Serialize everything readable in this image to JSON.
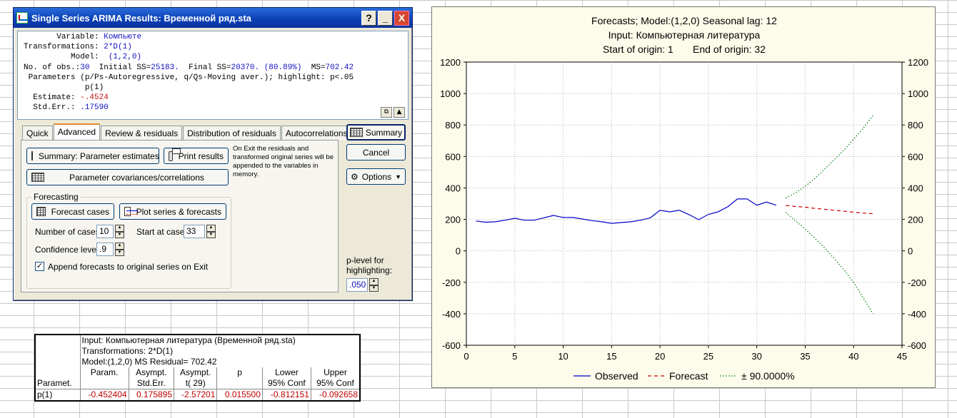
{
  "window": {
    "title": "Single Series ARIMA Results: Временной ряд.sta",
    "help": "?",
    "minimize": "_",
    "close": "X"
  },
  "results": {
    "variable_label": "Variable:",
    "variable": "Компьюте",
    "transformations_label": "Transformations:",
    "transformations": "2*D(1)",
    "model_label": "Model:",
    "model": "(1,2,0)",
    "obs_label": "No. of obs.:",
    "obs": "30",
    "initial_ss_label": "Initial SS=",
    "initial_ss": "25183.",
    "final_ss_label": "Final SS=",
    "final_ss": "20370. (80.89%)",
    "ms_label": "MS=",
    "ms": "702.42",
    "params_line": "Parameters (p/Ps-Autoregressive, q/Qs-Moving aver.); highlight: p<.05",
    "param_col": "p(1)",
    "estimate_label": "Estimate:",
    "estimate": "-.4524",
    "stderr_label": "Std.Err.:",
    "stderr": ".17590"
  },
  "tabs": [
    "Quick",
    "Advanced",
    "Review & residuals",
    "Distribution of residuals",
    "Autocorrelations"
  ],
  "advanced": {
    "summary_params": "Summary:  Parameter estimates",
    "print_results": "Print results",
    "note": "On Exit the residuals and transformed original series will be appended to the variables in memory.",
    "param_cov": "Parameter covariances/correlations",
    "forecasting_legend": "Forecasting",
    "forecast_cases": "Forecast cases",
    "plot_series": "Plot series & forecasts",
    "num_cases_label": "Number of cases:",
    "num_cases": "10",
    "start_case_label": "Start at case:",
    "start_case": "33",
    "confidence_label": "Confidence level:",
    "confidence": ".9",
    "append_label": "Append forecasts to original series on Exit",
    "append_checked": "✓"
  },
  "side": {
    "summary": "Summary",
    "cancel": "Cancel",
    "options": "Options",
    "plevel_label": "p-level for highlighting:",
    "plevel": ".050"
  },
  "sheet": {
    "header1": "Input: Компьютерная литература (Временной ряд.sta)",
    "header2": "Transformations: 2*D(1)",
    "header3": "Model:(1,2,0) MS Residual= 702.42",
    "row_header": "Paramet.",
    "cols": [
      [
        "Param.",
        ""
      ],
      [
        "Asympt.",
        "Std.Err."
      ],
      [
        "Asympt.",
        "t(    29)"
      ],
      [
        "p",
        ""
      ],
      [
        "Lower",
        "95% Conf"
      ],
      [
        "Upper",
        "95% Conf"
      ]
    ],
    "row_label": "p(1)",
    "row_values": [
      "-0.452404",
      "0.175895",
      "-2.57201",
      "0.015500",
      "-0.812151",
      "-0.092658"
    ]
  },
  "chart_data": {
    "type": "line",
    "title_lines": [
      "Forecasts; Model:(1,2,0) Seasonal lag: 12",
      "Input: Компьютерная литература",
      "Start of origin: 1       End of origin: 32"
    ],
    "xlim": [
      0,
      45
    ],
    "ylim": [
      -600,
      1200
    ],
    "xticks": [
      0,
      5,
      10,
      15,
      20,
      25,
      30,
      35,
      40,
      45
    ],
    "yticks": [
      -600,
      -400,
      -200,
      0,
      200,
      400,
      600,
      800,
      1000,
      1200
    ],
    "grid": true,
    "legend_position": "bottom",
    "series": [
      {
        "name": "Observed",
        "color": "#0000c8",
        "style": "solid",
        "x": [
          1,
          2,
          3,
          4,
          5,
          6,
          7,
          8,
          9,
          10,
          11,
          12,
          13,
          14,
          15,
          16,
          17,
          18,
          19,
          20,
          21,
          22,
          23,
          24,
          25,
          26,
          27,
          28,
          29,
          30,
          31,
          32
        ],
        "y": [
          190,
          182,
          185,
          195,
          207,
          195,
          195,
          210,
          225,
          212,
          212,
          202,
          192,
          185,
          175,
          180,
          185,
          195,
          210,
          258,
          248,
          258,
          230,
          198,
          232,
          248,
          280,
          330,
          330,
          290,
          310,
          290
        ]
      },
      {
        "name": "Forecast",
        "color": "#d00000",
        "style": "dashed",
        "x": [
          33,
          34,
          35,
          36,
          37,
          38,
          39,
          40,
          41,
          42
        ],
        "y": [
          288,
          282,
          278,
          270,
          264,
          258,
          252,
          246,
          240,
          236
        ]
      },
      {
        "name": "± 90.0000%",
        "color": "#008000",
        "style": "dotted",
        "x": [
          33,
          34,
          35,
          36,
          37,
          38,
          39,
          40,
          41,
          42
        ],
        "y": [
          335,
          370,
          410,
          460,
          520,
          580,
          640,
          710,
          780,
          860
        ]
      },
      {
        "name": "± 90.0000%",
        "color": "#008000",
        "style": "dotted",
        "x": [
          33,
          34,
          35,
          36,
          37,
          38,
          39,
          40,
          41,
          42
        ],
        "y": [
          245,
          190,
          140,
          80,
          20,
          -50,
          -120,
          -200,
          -300,
          -400
        ]
      }
    ],
    "legend": [
      "Observed",
      "Forecast",
      "± 90.0000%"
    ]
  }
}
